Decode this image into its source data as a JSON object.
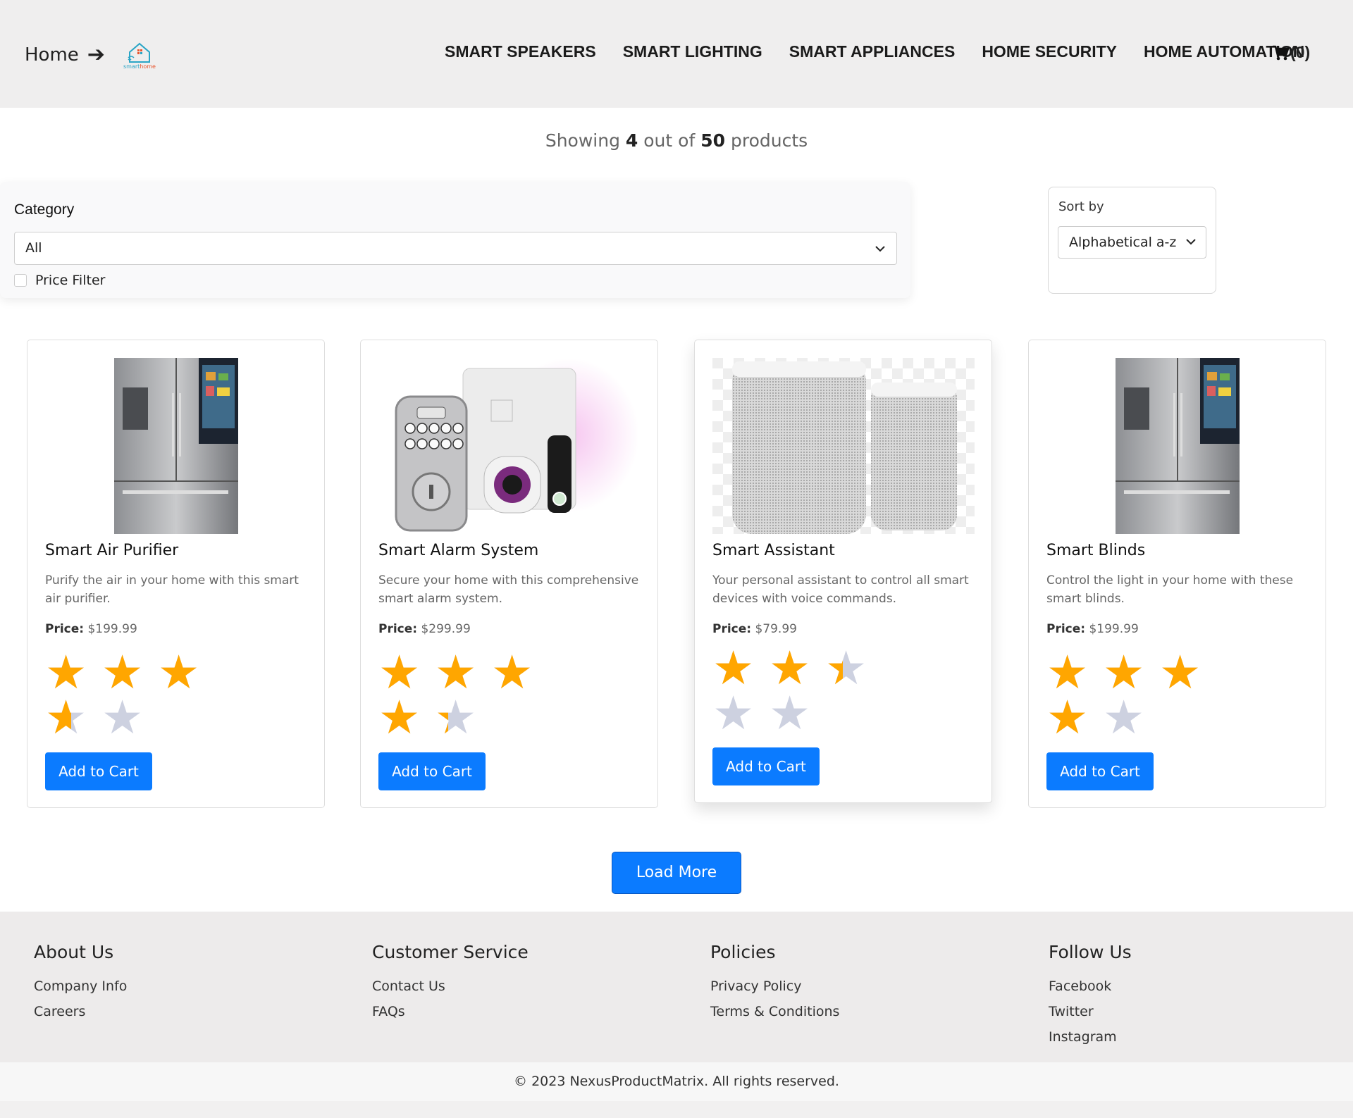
{
  "header": {
    "home_label": "Home",
    "logo_text": "smarthome",
    "nav": [
      "SMART SPEAKERS",
      "SMART LIGHTING",
      "SMART APPLIANCES",
      "HOME SECURITY",
      "HOME AUTOMATION"
    ],
    "cart_count": "(0)"
  },
  "results": {
    "prefix": "Showing",
    "shown": "4",
    "middle": "out of",
    "total": "50",
    "suffix": "products"
  },
  "filters": {
    "category_label": "Category",
    "category_value": "All",
    "price_filter_label": "Price Filter",
    "sort_label": "Sort by",
    "sort_value": "Alphabetical a-z"
  },
  "products": [
    {
      "title": "Smart Air Purifier",
      "description": "Purify the air in your home with this smart air purifier.",
      "price_label": "Price:",
      "price": "$199.99",
      "rating": 3.6,
      "button": "Add to Cart",
      "image": "refrigerator"
    },
    {
      "title": "Smart Alarm System",
      "description": "Secure your home with this comprehensive smart alarm system.",
      "price_label": "Price:",
      "price": "$299.99",
      "rating": 4.3,
      "button": "Add to Cart",
      "image": "alarm-kit"
    },
    {
      "title": "Smart Assistant",
      "description": "Your personal assistant to control all smart devices with voice commands.",
      "price_label": "Price:",
      "price": "$79.99",
      "rating": 2.4,
      "button": "Add to Cart",
      "image": "speakers"
    },
    {
      "title": "Smart Blinds",
      "description": "Control the light in your home with these smart blinds.",
      "price_label": "Price:",
      "price": "$199.99",
      "rating": 4.0,
      "button": "Add to Cart",
      "image": "refrigerator"
    }
  ],
  "load_more": "Load More",
  "footer": {
    "columns": [
      {
        "title": "About Us",
        "links": [
          "Company Info",
          "Careers"
        ]
      },
      {
        "title": "Customer Service",
        "links": [
          "Contact Us",
          "FAQs"
        ]
      },
      {
        "title": "Policies",
        "links": [
          "Privacy Policy",
          "Terms & Conditions"
        ]
      },
      {
        "title": "Follow Us",
        "links": [
          "Facebook",
          "Twitter",
          "Instagram"
        ]
      }
    ],
    "copyright": "© 2023 NexusProductMatrix. All rights reserved."
  },
  "colors": {
    "accent": "#0b7bff",
    "star": "#ffa600",
    "star_empty": "#cdd1e0"
  }
}
